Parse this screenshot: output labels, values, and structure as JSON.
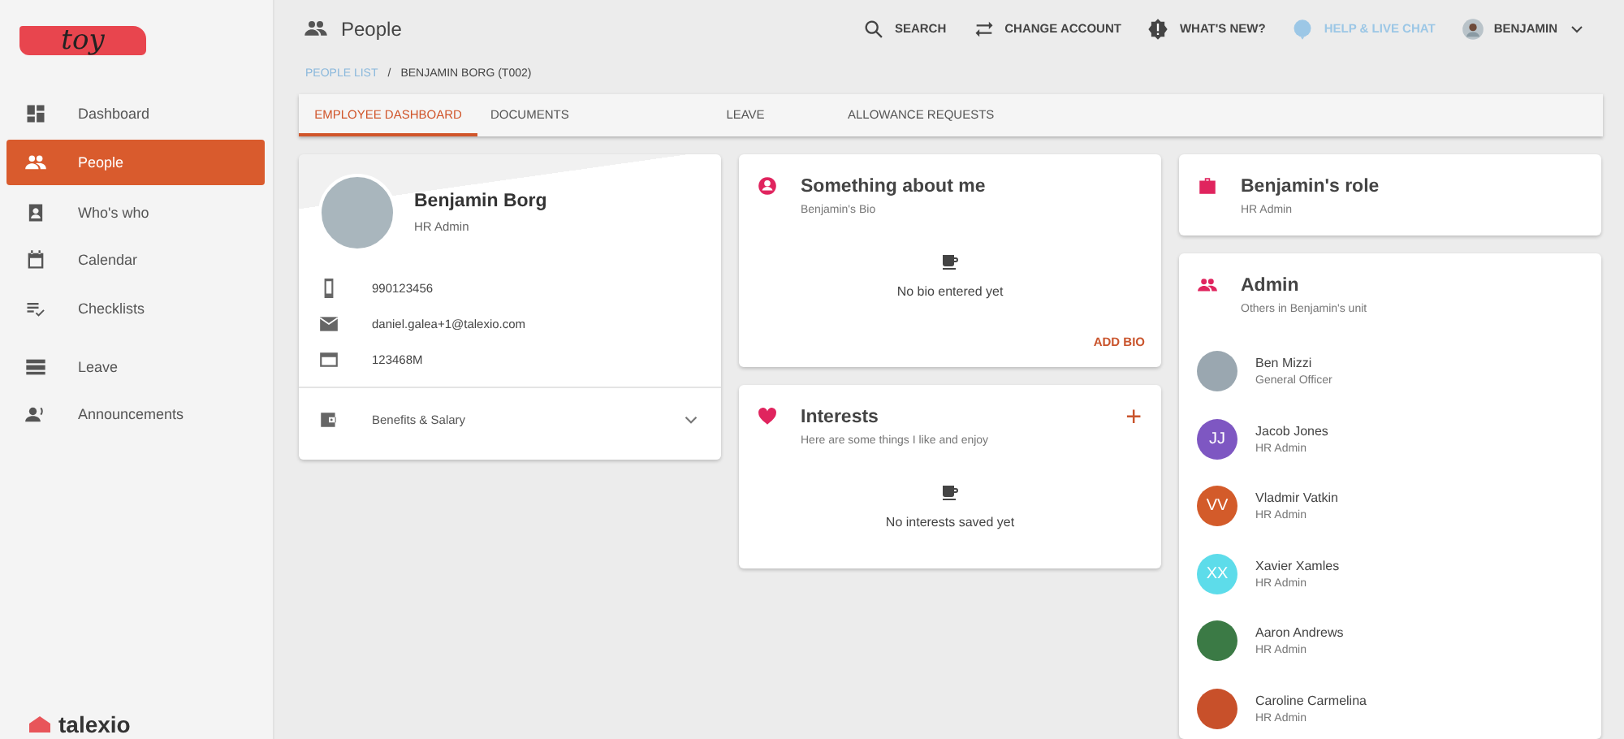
{
  "sidebar": {
    "logo": "toy",
    "items": [
      {
        "label": "Dashboard",
        "selected": false
      },
      {
        "label": "People",
        "selected": true
      },
      {
        "label": "Who's who",
        "selected": false
      },
      {
        "label": "Calendar",
        "selected": false
      },
      {
        "label": "Checklists",
        "selected": false
      },
      {
        "label": "Leave",
        "selected": false
      },
      {
        "label": "Announcements",
        "selected": false
      }
    ],
    "brand": "talexio"
  },
  "header": {
    "title": "People",
    "actions": [
      {
        "label": "SEARCH",
        "kind": "normal"
      },
      {
        "label": "CHANGE ACCOUNT",
        "kind": "normal"
      },
      {
        "label": "WHAT'S NEW?",
        "kind": "normal"
      },
      {
        "label": "HELP & LIVE CHAT",
        "kind": "muted"
      },
      {
        "label": "BENJAMIN",
        "kind": "user"
      }
    ]
  },
  "breadcrumb": [
    {
      "label": "PEOPLE LIST",
      "kind": "link"
    },
    {
      "label": "/",
      "kind": "separator"
    },
    {
      "label": "BENJAMIN BORG (T002)",
      "kind": "current"
    }
  ],
  "tabs": [
    {
      "label": "EMPLOYEE DASHBOARD",
      "selected": true
    },
    {
      "label": "DOCUMENTS",
      "selected": false
    },
    {
      "label": "LEAVE",
      "selected": false
    },
    {
      "label": "ALLOWANCE REQUESTS",
      "selected": false
    }
  ],
  "profile": {
    "name": "Benjamin Borg",
    "role": "HR Admin",
    "details": [
      {
        "value": "990123456"
      },
      {
        "value": "daniel.galea+1@talexio.com"
      },
      {
        "value": "123468M"
      }
    ],
    "benefits": {
      "label": "Benefits & Salary",
      "expanded": false
    }
  },
  "bio": {
    "title": "Something about me",
    "subtitle": "Benjamin's Bio",
    "empty": "No bio entered yet",
    "action": "ADD BIO"
  },
  "interests": {
    "title": "Interests",
    "subtitle": "Here are some things I like and enjoy",
    "empty": "No interests saved yet",
    "add": "+"
  },
  "role": {
    "title": "Benjamin's role",
    "subtitle": "HR Admin"
  },
  "unit": {
    "title": "Admin",
    "subtitle": "Others in Benjamin's unit",
    "members": [
      {
        "name": "Ben Mizzi",
        "role": "General Officer",
        "kind": "photo",
        "color": "#9aa7b0"
      },
      {
        "name": "Jacob Jones",
        "role": "HR Admin",
        "kind": "initials",
        "initials": "JJ",
        "color": "#7e57c2"
      },
      {
        "name": "Vladmir Vatkin",
        "role": "HR Admin",
        "kind": "initials",
        "initials": "VV",
        "color": "#d35b2a"
      },
      {
        "name": "Xavier Xamles",
        "role": "HR Admin",
        "kind": "initials",
        "initials": "XX",
        "color": "#5ddcea"
      },
      {
        "name": "Aaron Andrews",
        "role": "HR Admin",
        "kind": "plain",
        "color": "#3b7a45"
      },
      {
        "name": "Caroline Carmelina",
        "role": "HR Admin",
        "kind": "plain",
        "color": "#c8502a"
      }
    ]
  }
}
